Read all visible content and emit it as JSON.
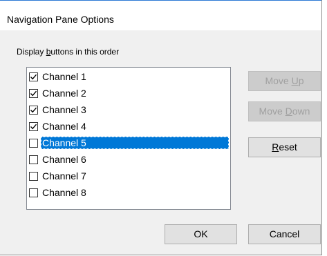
{
  "dialog": {
    "title": "Navigation Pane Options",
    "group_label": {
      "before": "Display ",
      "mnemonic": "b",
      "after": "uttons in this order"
    }
  },
  "list": {
    "items": [
      {
        "label": "Channel 1",
        "checked": true,
        "selected": false
      },
      {
        "label": "Channel 2",
        "checked": true,
        "selected": false
      },
      {
        "label": "Channel 3",
        "checked": true,
        "selected": false
      },
      {
        "label": "Channel 4",
        "checked": true,
        "selected": false
      },
      {
        "label": "Channel 5",
        "checked": false,
        "selected": true
      },
      {
        "label": "Channel 6",
        "checked": false,
        "selected": false
      },
      {
        "label": "Channel 7",
        "checked": false,
        "selected": false
      },
      {
        "label": "Channel 8",
        "checked": false,
        "selected": false
      }
    ]
  },
  "buttons": {
    "move_up": {
      "before": "Move ",
      "mnemonic": "U",
      "after": "p",
      "enabled": false
    },
    "move_down": {
      "before": "Move ",
      "mnemonic": "D",
      "after": "own",
      "enabled": false
    },
    "reset": {
      "before": "",
      "mnemonic": "R",
      "after": "eset",
      "enabled": true
    },
    "ok": {
      "label": "OK"
    },
    "cancel": {
      "label": "Cancel"
    }
  },
  "colors": {
    "selection": "#0078d7",
    "dialog_bg": "#f0f0f0",
    "disabled_text": "#a0a0a0"
  }
}
